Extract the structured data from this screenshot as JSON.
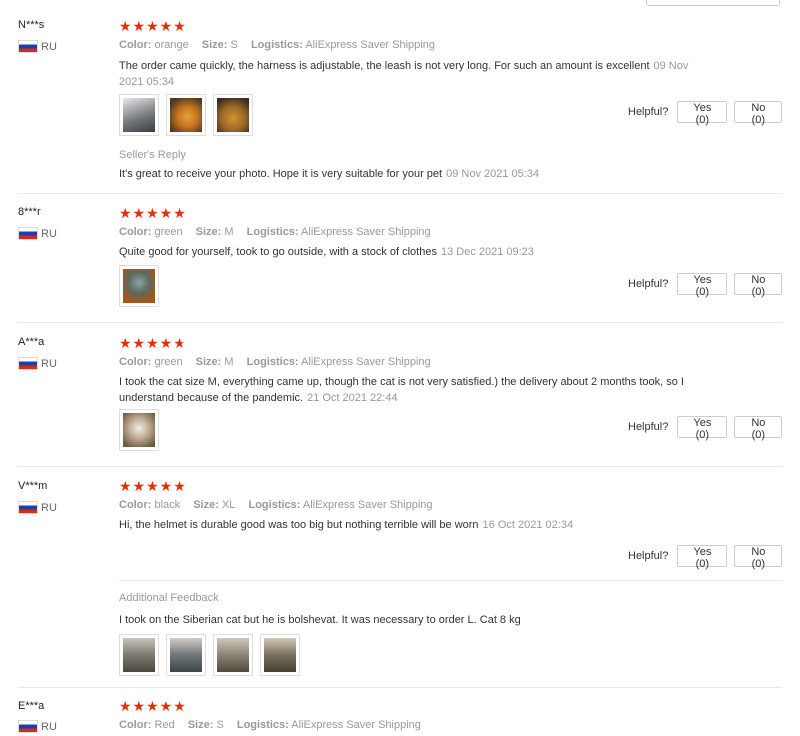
{
  "helpful_label": "Helpful?",
  "attr_labels": {
    "color": "Color:",
    "size": "Size:",
    "logistics": "Logistics:"
  },
  "reviews": [
    {
      "user": "N***s",
      "country": "RU",
      "stars": "★★★★★",
      "color": "orange",
      "size": "S",
      "logistics": "AliExpress Saver Shipping",
      "text": "The order came quickly, the harness is adjustable, the leash is not very long. For such an amount is excellent",
      "date": "09 Nov 2021 05:34",
      "yes": "Yes (0)",
      "no": "No (0)",
      "reply_label": "Seller's Reply",
      "reply_text": "It's great to receive your photo. Hope it is very suitable for your pet",
      "reply_date": "09 Nov 2021 05:34"
    },
    {
      "user": "8***r",
      "country": "RU",
      "stars": "★★★★★",
      "color": "green",
      "size": "M",
      "logistics": "AliExpress Saver Shipping",
      "text": "Quite good for yourself, took to go outside, with a stock of clothes",
      "date": "13 Dec 2021 09:23",
      "yes": "Yes (0)",
      "no": "No (0)"
    },
    {
      "user": "A***a",
      "country": "RU",
      "stars": "★★★★",
      "rating": 4.7,
      "color": "green",
      "size": "M",
      "logistics": "AliExpress Saver Shipping",
      "text": "I took the cat size M, everything came up, though the cat is not very satisfied.) the delivery about 2 months took, so I understand because of the pandemic.",
      "date": "21 Oct 2021 22:44",
      "yes": "Yes (0)",
      "no": "No (0)"
    },
    {
      "user": "V***m",
      "country": "RU",
      "stars": "★★★★★",
      "color": "black",
      "size": "XL",
      "logistics": "AliExpress Saver Shipping",
      "text": "Hi, the helmet is durable good was too big but nothing terrible will be worn",
      "date": "16 Oct 2021 02:34",
      "yes": "Yes (0)",
      "no": "No (0)",
      "additional_label": "Additional Feedback",
      "additional_text": "I took on the Siberian cat but he is bolshevat. It was necessary to order L. Cat 8 kg"
    },
    {
      "user": "E***a",
      "country": "RU",
      "stars": "★★★★★",
      "color": "Red",
      "size": "S",
      "logistics": "AliExpress Saver Shipping"
    }
  ],
  "photo_colors": {
    "r1": [
      "#6f7378",
      "#c5731d",
      "#9c6a2a"
    ],
    "r2": [
      "#5b6b5e"
    ],
    "r3": [
      "#b9a48a"
    ],
    "r4": [
      "#7e7a70",
      "#6e7679",
      "#8a8474",
      "#7a6f5e"
    ]
  }
}
